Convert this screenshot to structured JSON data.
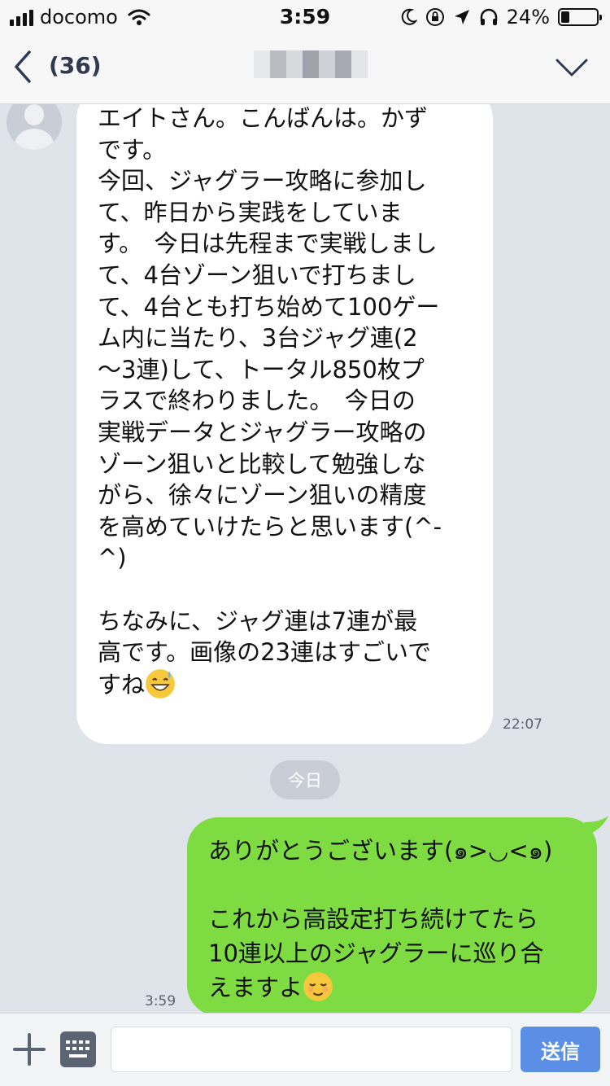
{
  "status_bar": {
    "carrier": "docomo",
    "time": "3:59",
    "battery_text": "24%",
    "battery_level": 0.24
  },
  "header": {
    "unread_count": "(36)",
    "title": ""
  },
  "messages": {
    "incoming": {
      "text": "エイトさん。こんばんは。かず\nです。\n今回、ジャグラー攻略に参加し\nて、昨日から実践をしていま\nす。　今日は先程まで実戦しまし\nて、4台ゾーン狙いで打ちまし\nて、4台とも打ち始めて100ゲー\nム内に当たり、3台ジャグ連(2\n〜3連)して、トータル850枚プ\nラスで終わりました。　今日の\n実戦データとジャグラー攻略の\nゾーン狙いと比較して勉強しな\nがら、徐々にゾーン狙いの精度\nを高めていけたらと思います(^-\n^)\n\nちなみに、ジャグ連は7連が最\n高です。画像の23連はすごいで\nすね",
      "emoji": "sweat-smile",
      "time": "22:07"
    },
    "date_divider": "今日",
    "outgoing": {
      "text": "ありがとうございます(๑>◡<๑)\n\nこれから高設定打ち続けてたら\n10連以上のジャグラーに巡り合\nえますよ",
      "emoji": "relieved",
      "time": "3:59"
    }
  },
  "input_bar": {
    "placeholder": "",
    "send_label": "送信"
  },
  "colors": {
    "chat_bg": "#dfe3ea",
    "outgoing_bubble": "#7edc42",
    "incoming_bubble": "#ffffff",
    "send_button": "#5b8fe6"
  }
}
